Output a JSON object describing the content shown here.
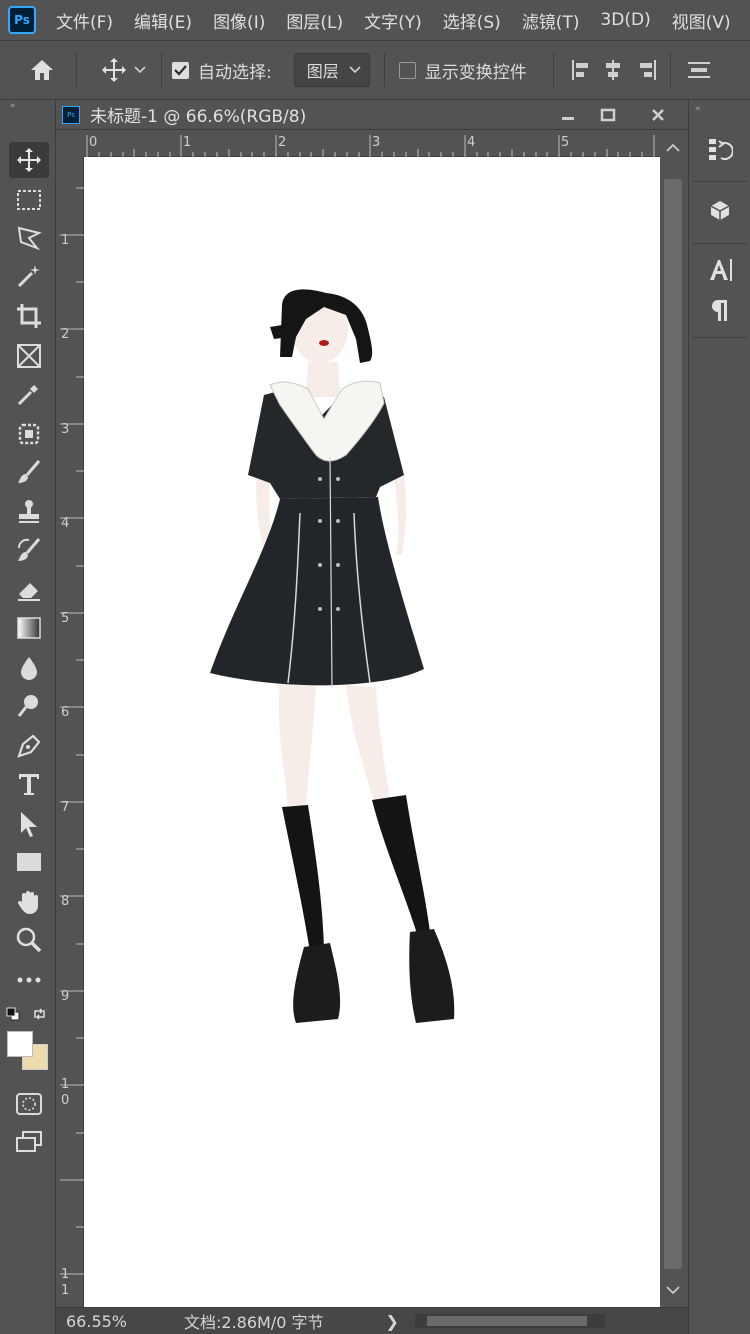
{
  "app": {
    "logo_text": "Ps"
  },
  "menu": [
    "文件(F)",
    "编辑(E)",
    "图像(I)",
    "图层(L)",
    "文字(Y)",
    "选择(S)",
    "滤镜(T)",
    "3D(D)",
    "视图(V)"
  ],
  "options_bar": {
    "auto_select_label": "自动选择:",
    "auto_select_checked": true,
    "target_select_value": "图层",
    "show_transform_label": "显示变换控件",
    "show_transform_checked": false
  },
  "document": {
    "tab_title": "未标题-1 @ 66.6%(RGB/8)",
    "ruler_top_labels": [
      "0",
      "1",
      "2",
      "3",
      "4",
      "5"
    ],
    "ruler_left_labels": [
      "1",
      "2",
      "3",
      "4",
      "5",
      "6",
      "7",
      "8",
      "9",
      "1\n0",
      "1\n1"
    ]
  },
  "status": {
    "zoom": "66.55%",
    "doc_info": "文档:2.86M/0 字节",
    "arrow": "❯"
  },
  "tools": [
    "move-tool",
    "marquee-tool",
    "lasso-tool",
    "magic-wand-tool",
    "crop-tool",
    "frame-tool",
    "eyedropper-tool",
    "healing-tool",
    "brush-tool",
    "stamp-tool",
    "history-brush-tool",
    "eraser-tool",
    "gradient-tool",
    "blur-tool",
    "dodge-tool",
    "pen-tool",
    "type-tool",
    "path-select-tool",
    "rectangle-tool",
    "hand-tool",
    "zoom-tool",
    "more-tools"
  ],
  "colors": {
    "foreground": "#ffffff",
    "background": "#eedcad",
    "ui_dark": "#535353",
    "ps_blue": "#31a8ff"
  }
}
